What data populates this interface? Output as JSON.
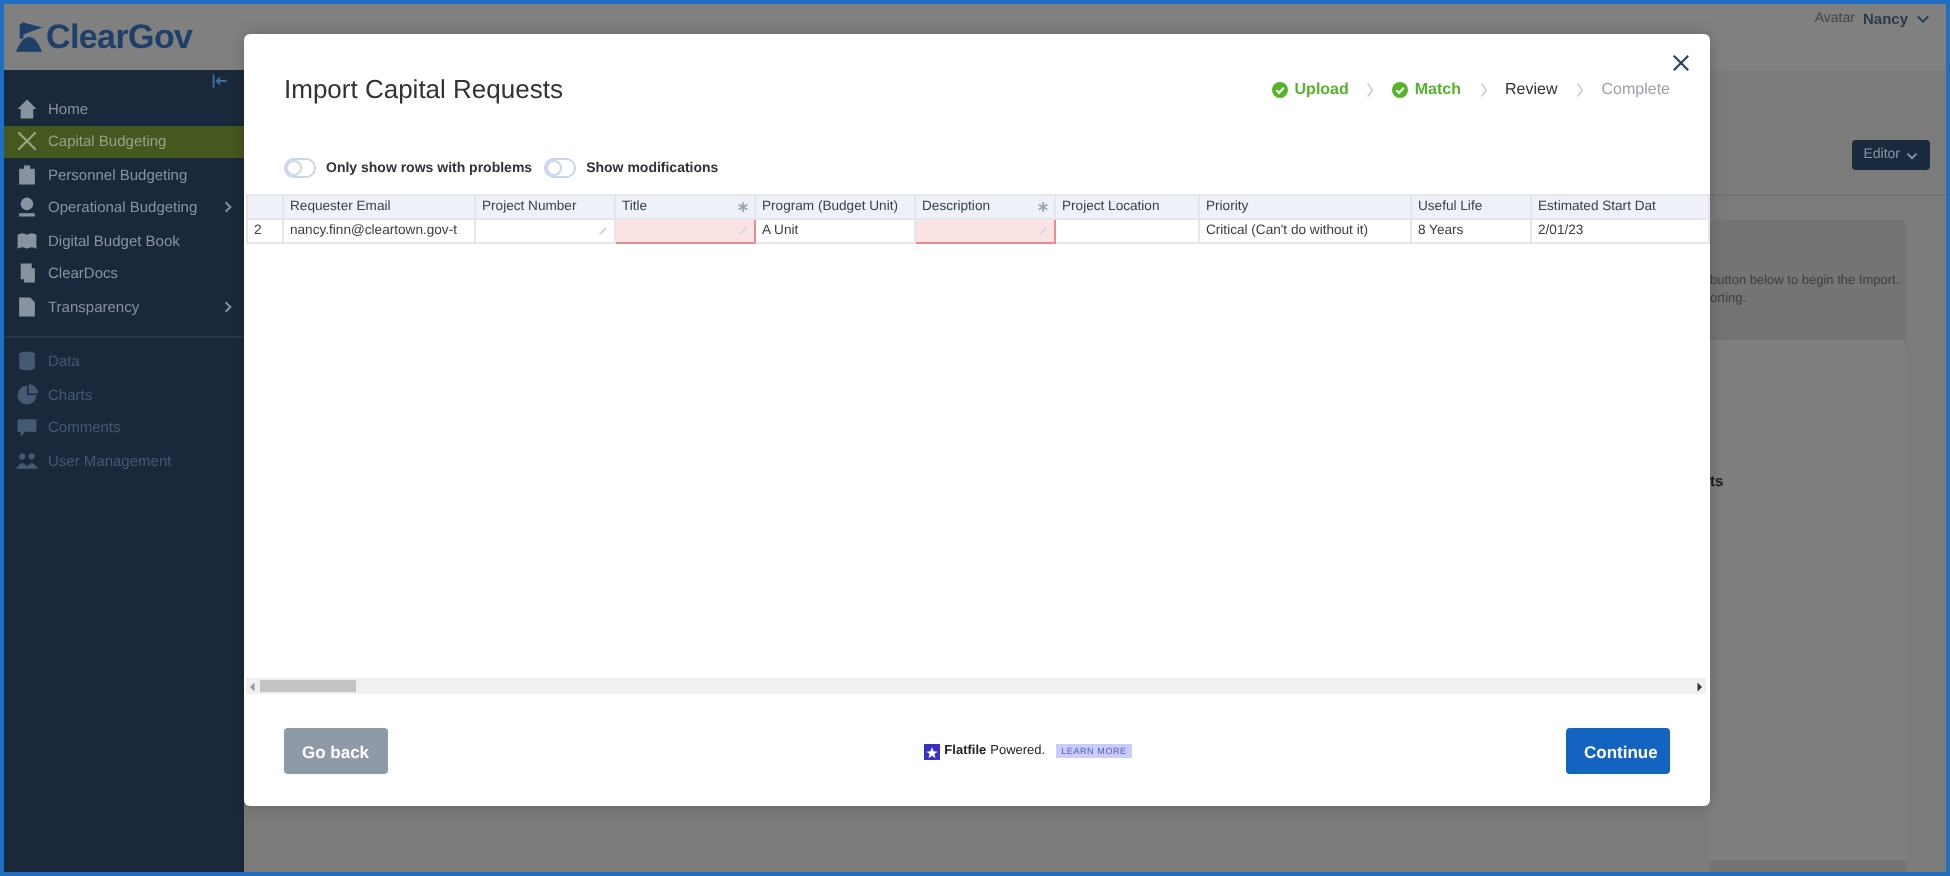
{
  "header": {
    "logo": "ClearGov",
    "avatar_alt": "Avatar",
    "user_name": "Nancy"
  },
  "sidebar": {
    "items": [
      {
        "label": "Home",
        "selected": false,
        "disabled": false,
        "has_submenu": false
      },
      {
        "label": "Capital Budgeting",
        "selected": true,
        "disabled": false,
        "has_submenu": false
      },
      {
        "label": "Personnel Budgeting",
        "selected": false,
        "disabled": false,
        "has_submenu": false
      },
      {
        "label": "Operational Budgeting",
        "selected": false,
        "disabled": false,
        "has_submenu": true
      },
      {
        "label": "Digital Budget Book",
        "selected": false,
        "disabled": false,
        "has_submenu": false
      },
      {
        "label": "ClearDocs",
        "selected": false,
        "disabled": false,
        "has_submenu": false
      },
      {
        "label": "Transparency",
        "selected": false,
        "disabled": false,
        "has_submenu": true
      },
      {
        "label": "Data",
        "selected": false,
        "disabled": true,
        "has_submenu": false
      },
      {
        "label": "Charts",
        "selected": false,
        "disabled": true,
        "has_submenu": false
      },
      {
        "label": "Comments",
        "selected": false,
        "disabled": true,
        "has_submenu": false
      },
      {
        "label": "User Management",
        "selected": false,
        "disabled": true,
        "has_submenu": false
      }
    ]
  },
  "background": {
    "editor_button": "Editor",
    "texts": [
      "button below to begin the Import.",
      "orting."
    ],
    "card_text": "ts"
  },
  "modal": {
    "title": "Import Capital Requests",
    "steps": [
      {
        "label": "Upload",
        "completed": true,
        "selected": false
      },
      {
        "label": "Match",
        "completed": true,
        "selected": false
      },
      {
        "label": "Review",
        "completed": false,
        "selected": true
      },
      {
        "label": "Complete",
        "completed": false,
        "selected": false
      }
    ],
    "toggles": [
      {
        "label": "Only show rows with problems",
        "on": false
      },
      {
        "label": "Show modifications",
        "on": false
      }
    ],
    "table": {
      "columns": [
        {
          "label": "Requester Email",
          "required": false
        },
        {
          "label": "Project Number",
          "required": false
        },
        {
          "label": "Title",
          "required": true
        },
        {
          "label": "Program (Budget Unit)",
          "required": false
        },
        {
          "label": "Description",
          "required": true
        },
        {
          "label": "Project Location",
          "required": false
        },
        {
          "label": "Priority",
          "required": false
        },
        {
          "label": "Useful Life",
          "required": false
        },
        {
          "label": "Estimated Start Dat",
          "required": false
        }
      ],
      "rows": [
        {
          "number": "2",
          "cells": [
            {
              "value": "nancy.finn@cleartown.gov-t",
              "error": false,
              "editable": false
            },
            {
              "error": false,
              "editable": true
            },
            {
              "error": true,
              "editable": true
            },
            {
              "value": "A Unit",
              "error": false,
              "editable": false
            },
            {
              "error": true,
              "editable": true
            },
            {
              "error": false,
              "editable": false
            },
            {
              "value": "Critical (Can't do without it)",
              "error": false,
              "editable": false
            },
            {
              "value": "8 Years",
              "error": false,
              "editable": false
            },
            {
              "value": "2/01/23",
              "error": false,
              "editable": false
            }
          ]
        }
      ]
    },
    "footer": {
      "back_button": "Go back",
      "brand": "Flatfile",
      "powered": "Powered.",
      "learn_more": "LEARN MORE",
      "continue_button": "Continue"
    }
  }
}
